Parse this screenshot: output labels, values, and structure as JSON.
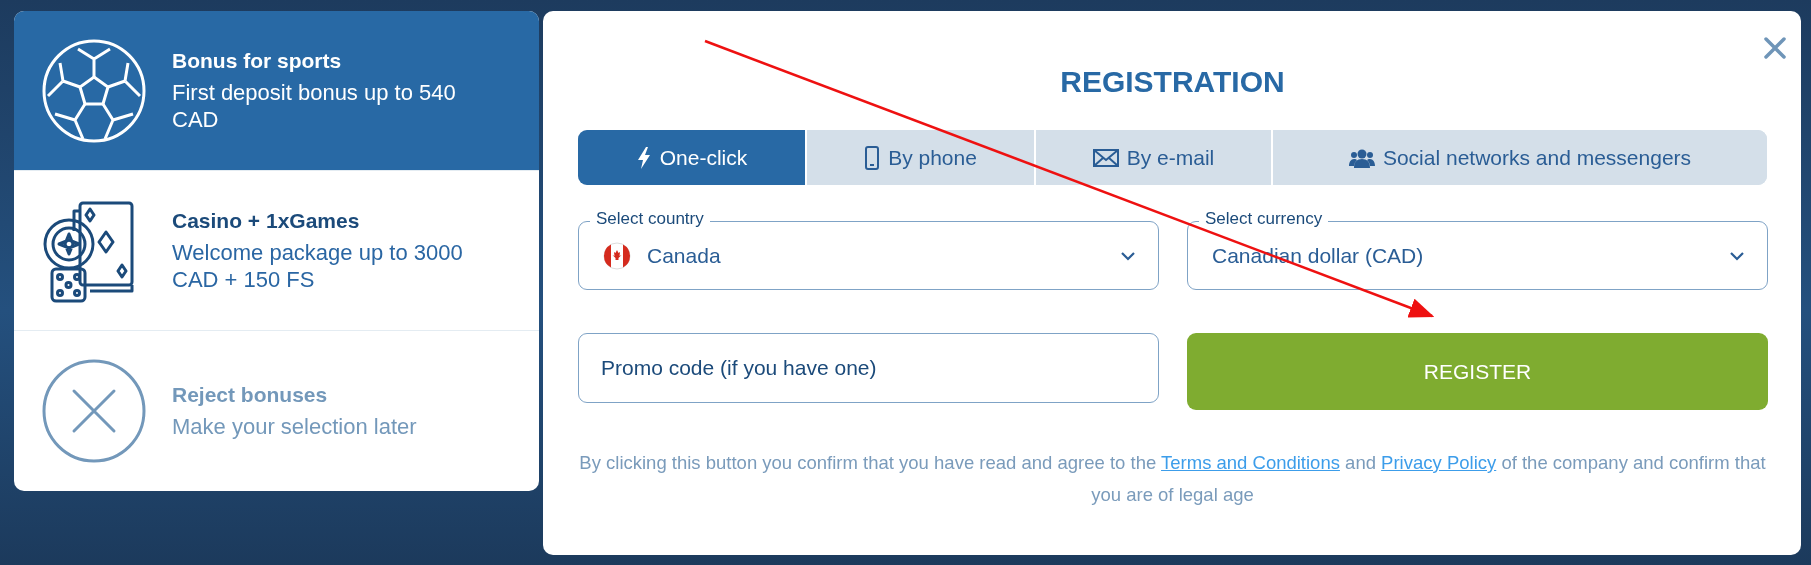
{
  "bonus_options": [
    {
      "kind": "sports",
      "title": "Bonus for sports",
      "description": "First deposit bonus up to 540 CAD",
      "selected": true
    },
    {
      "kind": "casino",
      "title": "Casino + 1xGames",
      "description": "Welcome package up to 3000 CAD + 150 FS",
      "selected": false
    },
    {
      "kind": "reject",
      "title": "Reject bonuses",
      "description": "Make your selection later",
      "selected": false
    }
  ],
  "dialog": {
    "title": "REGISTRATION",
    "tabs": [
      {
        "kind": "bolt",
        "label": "One-click",
        "selected": true
      },
      {
        "kind": "phone",
        "label": "By phone",
        "selected": false
      },
      {
        "kind": "mail",
        "label": "By e-mail",
        "selected": false
      },
      {
        "kind": "people",
        "label": "Social networks and messengers",
        "selected": false
      }
    ],
    "country": {
      "label": "Select country",
      "value": "Canada"
    },
    "currency": {
      "label": "Select currency",
      "value": "Canadian dollar (CAD)"
    },
    "promo": {
      "placeholder": "Promo code (if you have one)"
    },
    "register_button": "REGISTER",
    "terms": {
      "before": "By clicking this button you confirm that you have read and agree to the",
      "link_1": "Terms and Conditions",
      "middle": "and",
      "link_2": "Privacy Policy",
      "after": "of the company and confirm that you are of legal age"
    }
  }
}
